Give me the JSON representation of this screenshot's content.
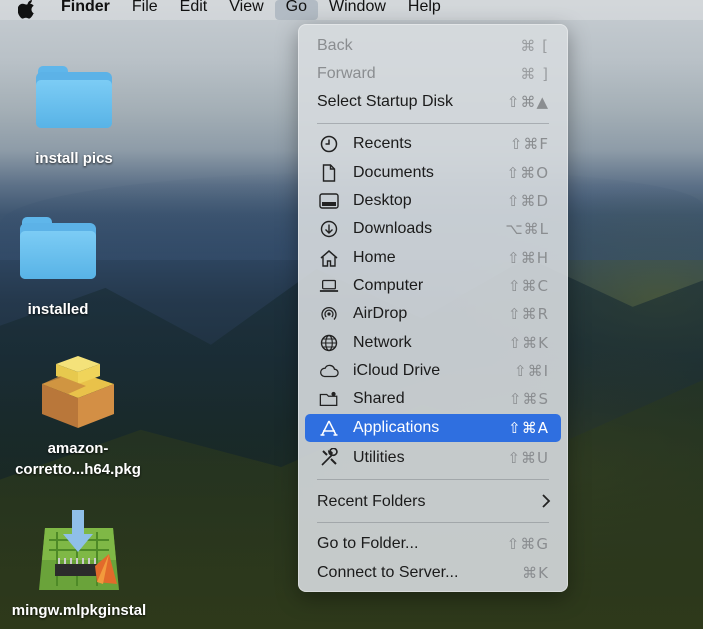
{
  "menubar": {
    "apple": "apple-icon",
    "app_name": "Finder",
    "items": [
      "File",
      "Edit",
      "View",
      "Go",
      "Window",
      "Help"
    ]
  },
  "desktop": {
    "icons": [
      {
        "label": "install pics",
        "type": "folder"
      },
      {
        "label": "installed",
        "type": "folder"
      },
      {
        "label_line1": "amazon-",
        "label_line2": "corretto...h64.pkg",
        "type": "package"
      },
      {
        "label": "mingw.mlpkginstal",
        "type": "installer"
      }
    ]
  },
  "go_menu": {
    "back": {
      "label": "Back",
      "shortcut": "⌘ ["
    },
    "forward": {
      "label": "Forward",
      "shortcut": "⌘ ]"
    },
    "startup": {
      "label": "Select Startup Disk",
      "shortcut": "⇧⌘▲"
    },
    "items": [
      {
        "label": "Recents",
        "shortcut": "⇧⌘F",
        "icon": "clock-icon"
      },
      {
        "label": "Documents",
        "shortcut": "⇧⌘O",
        "icon": "document-icon"
      },
      {
        "label": "Desktop",
        "shortcut": "⇧⌘D",
        "icon": "desktop-icon"
      },
      {
        "label": "Downloads",
        "shortcut": "⌥⌘L",
        "icon": "download-icon"
      },
      {
        "label": "Home",
        "shortcut": "⇧⌘H",
        "icon": "home-icon"
      },
      {
        "label": "Computer",
        "shortcut": "⇧⌘C",
        "icon": "laptop-icon"
      },
      {
        "label": "AirDrop",
        "shortcut": "⇧⌘R",
        "icon": "airdrop-icon"
      },
      {
        "label": "Network",
        "shortcut": "⇧⌘K",
        "icon": "globe-icon"
      },
      {
        "label": "iCloud Drive",
        "shortcut": "⇧⌘I",
        "icon": "cloud-icon"
      },
      {
        "label": "Shared",
        "shortcut": "⇧⌘S",
        "icon": "shared-folder-icon"
      },
      {
        "label": "Applications",
        "shortcut": "⇧⌘A",
        "icon": "applications-icon",
        "selected": true
      },
      {
        "label": "Utilities",
        "shortcut": "⇧⌘U",
        "icon": "utilities-icon"
      }
    ],
    "recent_folders": {
      "label": "Recent Folders"
    },
    "goto_folder": {
      "label": "Go to Folder...",
      "shortcut": "⇧⌘G"
    },
    "connect_server": {
      "label": "Connect to Server...",
      "shortcut": "⌘K"
    },
    "accent_color": "#2f6fe0"
  }
}
